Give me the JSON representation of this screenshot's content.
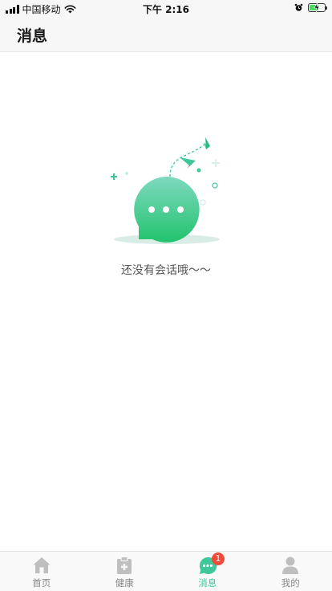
{
  "status_bar": {
    "carrier": "中国移动",
    "time": "下午 2:16"
  },
  "header": {
    "title": "消息"
  },
  "empty_state": {
    "message": "还没有会话哦～～"
  },
  "tab_bar": {
    "tabs": [
      {
        "label": "首页",
        "icon": "home-icon"
      },
      {
        "label": "健康",
        "icon": "health-clipboard-icon"
      },
      {
        "label": "消息",
        "icon": "chat-bubble-icon",
        "badge": "1",
        "active": true
      },
      {
        "label": "我的",
        "icon": "profile-icon"
      }
    ]
  },
  "colors": {
    "accent": "#3dc79a",
    "badge": "#f04a3a",
    "inactive": "#bfbfbf"
  }
}
